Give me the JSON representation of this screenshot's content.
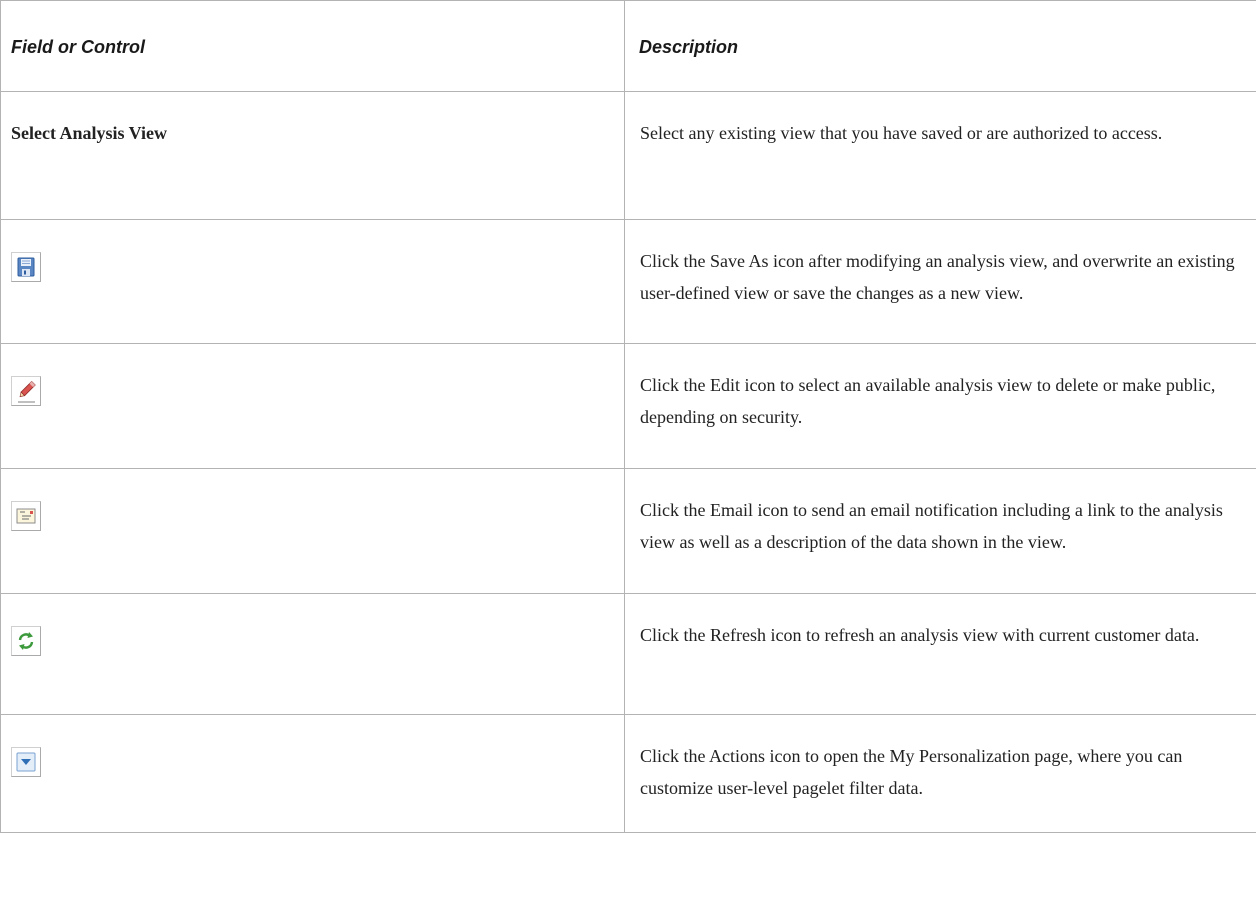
{
  "table": {
    "headers": {
      "field": "Field or Control",
      "description": "Description"
    },
    "rows": [
      {
        "field_label": "Select Analysis View",
        "description": "Select any existing view that you have saved or are authorized to access."
      },
      {
        "icon": "save-as-icon",
        "description": "Click the Save As icon after modifying an analysis view, and overwrite an existing user-defined view or save the changes as a new view."
      },
      {
        "icon": "edit-icon",
        "description": "Click the Edit icon to select an available analysis view to delete or make public, depending on security."
      },
      {
        "icon": "email-icon",
        "description": "Click the Email icon to send an email notification including a link to the analysis view as well as a description of the data shown in the view."
      },
      {
        "icon": "refresh-icon",
        "description": "Click the Refresh icon to refresh an analysis view with current customer data."
      },
      {
        "icon": "actions-icon",
        "description": "Click the Actions icon to open the My Personalization page, where you can customize user-level pagelet filter data."
      }
    ]
  }
}
